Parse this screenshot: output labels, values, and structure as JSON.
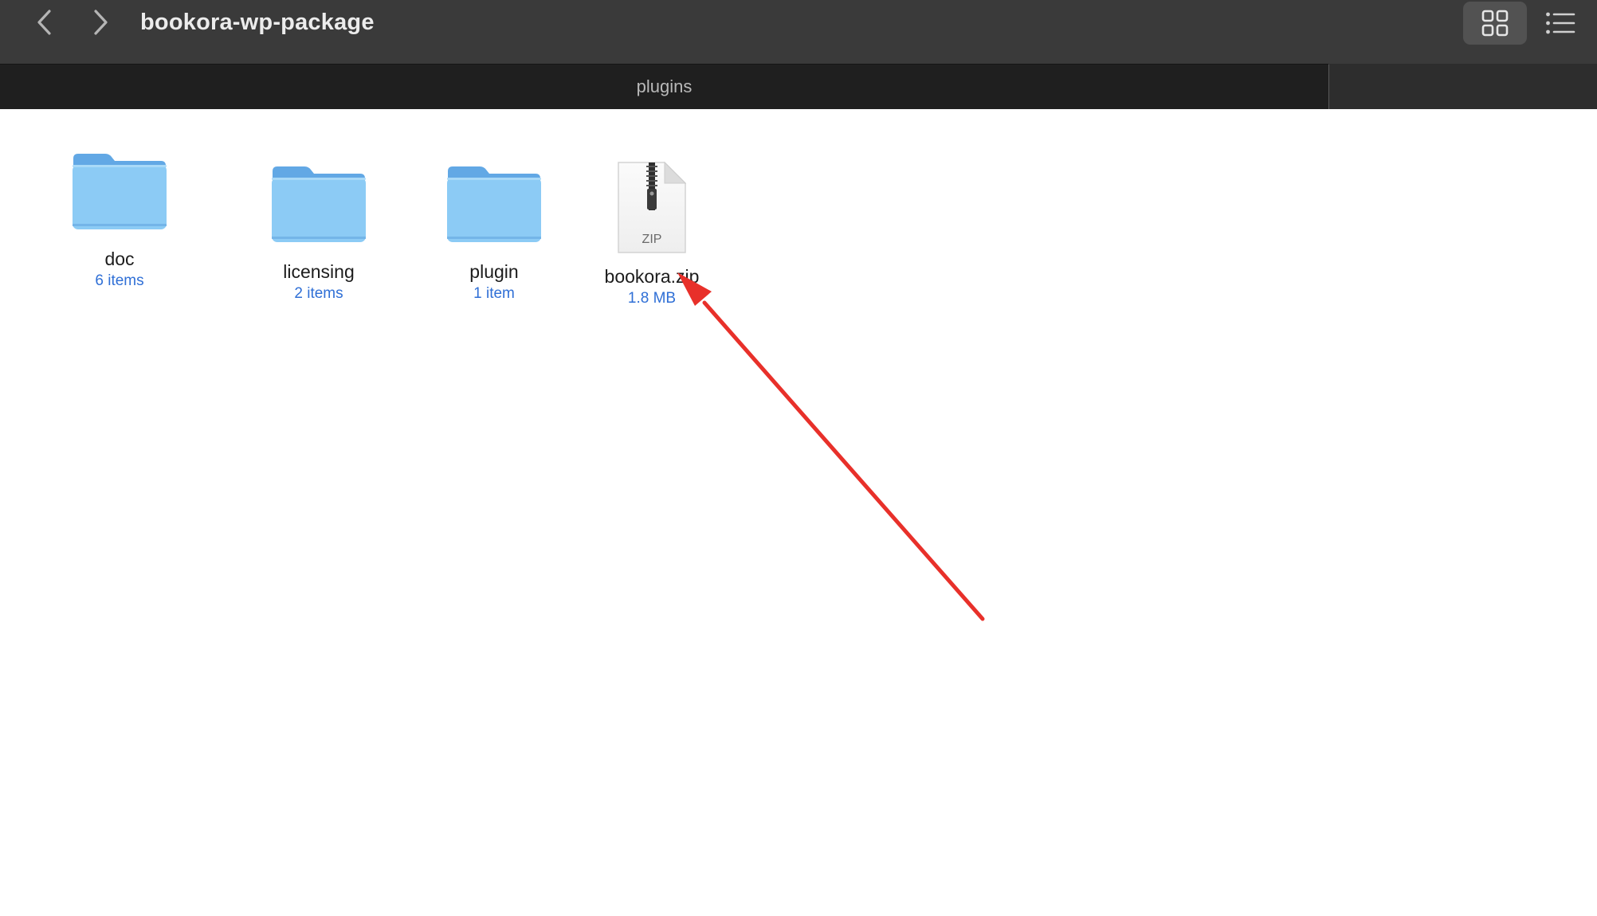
{
  "window": {
    "title": "bookora-wp-package"
  },
  "toolbar": {
    "back_icon": "chevron-left-icon",
    "forward_icon": "chevron-right-icon",
    "grid_view_icon": "grid-view-icon",
    "list_view_icon": "list-view-icon",
    "grid_view_selected": true
  },
  "tabs": [
    {
      "label": "plugins",
      "active": true
    }
  ],
  "items": [
    {
      "name": "doc",
      "meta": "6 items",
      "kind": "folder"
    },
    {
      "name": "licensing",
      "meta": "2 items",
      "kind": "folder"
    },
    {
      "name": "plugin",
      "meta": "1 item",
      "kind": "folder"
    },
    {
      "name": "bookora.zip",
      "meta": "1.8 MB",
      "kind": "zip",
      "icon_label": "ZIP"
    }
  ],
  "colors": {
    "titlebar": "#3a3a3a",
    "tabbar": "#1f1f1f",
    "folder": "#8ccbf5",
    "folder_tab": "#62a8e5",
    "meta_text": "#2f6fd6",
    "annotation": "#e8302a"
  },
  "annotation": {
    "type": "arrow",
    "color": "#e8302a",
    "points_to": "bookora.zip"
  }
}
